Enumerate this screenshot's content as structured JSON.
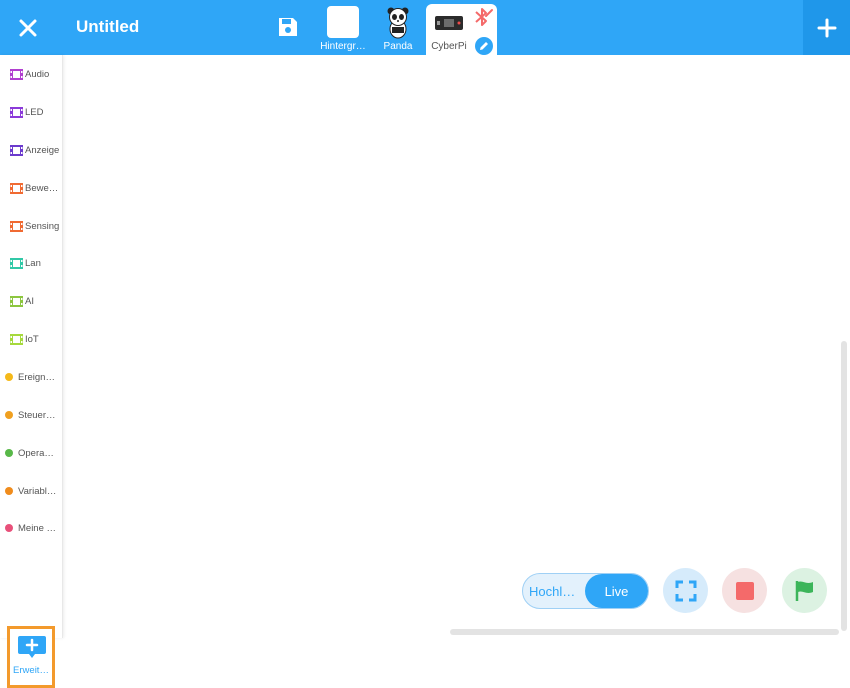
{
  "header": {
    "title": "Untitled",
    "icons": {
      "close": "close-icon",
      "save": "save-icon",
      "add": "plus-icon"
    }
  },
  "tabs": [
    {
      "label": "Hintergr…",
      "icon": "backdrop-thumbnail",
      "active": false
    },
    {
      "label": "Panda",
      "icon": "panda-sprite-thumbnail",
      "active": false
    },
    {
      "label": "CyberPi",
      "icon": "cyberpi-device-thumbnail",
      "active": true,
      "badges": [
        "bluetooth-disconnected-icon",
        "edit-pencil-icon"
      ]
    }
  ],
  "categories": [
    {
      "label": "Audio",
      "color": "#b13fd0",
      "kind": "device"
    },
    {
      "label": "LED",
      "color": "#8b3ad9",
      "kind": "device"
    },
    {
      "label": "Anzeige",
      "color": "#6b3acd",
      "kind": "device"
    },
    {
      "label": "Bewe…",
      "color": "#f06a32",
      "kind": "device"
    },
    {
      "label": "Sensing",
      "color": "#f06a32",
      "kind": "device"
    },
    {
      "label": "Lan",
      "color": "#31c8a7",
      "kind": "device"
    },
    {
      "label": "AI",
      "color": "#8cc63f",
      "kind": "device"
    },
    {
      "label": "IoT",
      "color": "#a6d93c",
      "kind": "device"
    },
    {
      "label": "Ereign…",
      "color": "#f5b919",
      "kind": "dot"
    },
    {
      "label": "Steuer…",
      "color": "#f0a020",
      "kind": "dot"
    },
    {
      "label": "Opera…",
      "color": "#58b848",
      "kind": "dot"
    },
    {
      "label": "Variabl…",
      "color": "#f08c1c",
      "kind": "dot"
    },
    {
      "label": "Meine …",
      "color": "#e8507a",
      "kind": "dot"
    }
  ],
  "extension": {
    "label": "Erweit…",
    "icon": "add-extension-icon"
  },
  "mode": {
    "upload_label": "Hochl…",
    "live_label": "Live",
    "selected": "Live"
  },
  "controls": {
    "fullscreen": {
      "icon": "fullscreen-icon",
      "bg": "#d6ebfb",
      "color": "#2fa6f7"
    },
    "stop": {
      "icon": "stop-icon",
      "bg": "#f6e1e1",
      "color": "#f46a6a"
    },
    "run": {
      "icon": "green-flag-icon",
      "bg": "#dcf2e2",
      "color": "#3cb55a"
    }
  },
  "colors": {
    "accent": "#2fa6f7",
    "accent_dark": "#1f97ea",
    "extension_border": "#f39a2c"
  }
}
